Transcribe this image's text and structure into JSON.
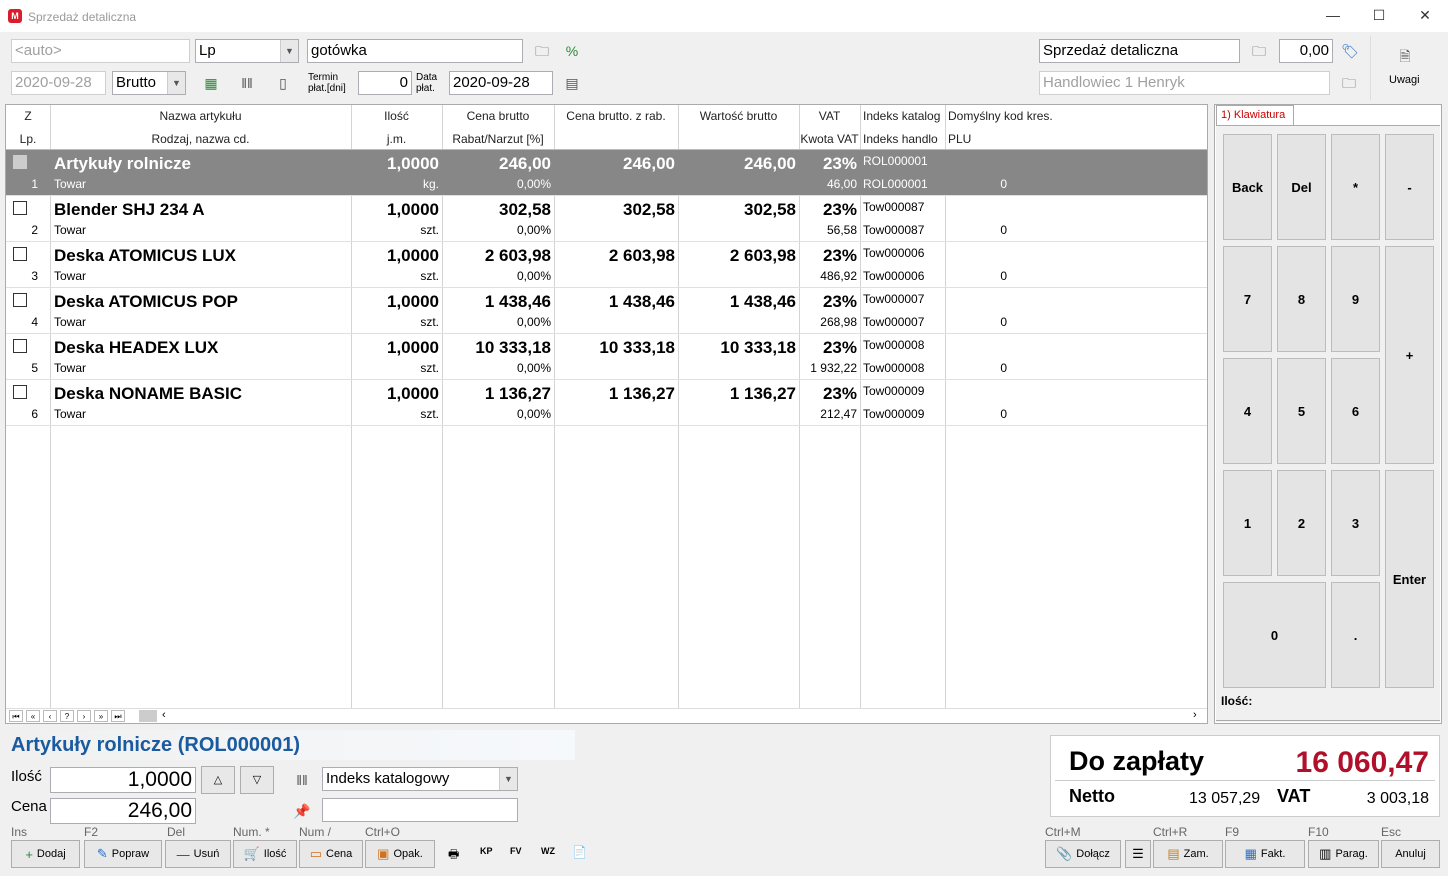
{
  "window": {
    "title": "Sprzedaż detaliczna",
    "app_icon": "M",
    "minimize": "—",
    "maximize": "☐",
    "close": "✕"
  },
  "header": {
    "doc_number_placeholder": "<auto>",
    "numbering": "Lp",
    "date": "2020-09-28",
    "price_type": "Brutto",
    "payment": "gotówka",
    "term_label": "Termin płat.[dni]",
    "term_value": "0",
    "due_label": "Data płat.",
    "due_date": "2020-09-28",
    "register": "Sprzedaż detaliczna",
    "amount": "0,00",
    "salesperson": "Handlowiec 1 Henryk",
    "notes_label": "Uwagi"
  },
  "grid": {
    "headers_top": [
      "Z",
      "Nazwa artykułu",
      "Ilość",
      "Cena brutto",
      "Cena brutto. z rab.",
      "Wartość brutto",
      "VAT",
      "Indeks katalog",
      "Domyślny kod kres."
    ],
    "headers_bottom": [
      "Lp.",
      "Rodzaj, nazwa cd.",
      "j.m.",
      "Rabat/Narzut [%]",
      "",
      "",
      "Kwota VAT",
      "Indeks handlo",
      "PLU"
    ],
    "rows": [
      {
        "lp": "1",
        "name": "Artykuły rolnicze",
        "type": "Towar",
        "qty": "1,0000",
        "unit": "kg.",
        "price": "246,00",
        "discount": "0,00%",
        "price_disc": "246,00",
        "value": "246,00",
        "vat": "23%",
        "vat_amount": "46,00",
        "cat_index": "ROL000001",
        "trade_index": "ROL000001",
        "plu": "0"
      },
      {
        "lp": "2",
        "name": "Blender SHJ 234 A",
        "type": "Towar",
        "qty": "1,0000",
        "unit": "szt.",
        "price": "302,58",
        "discount": "0,00%",
        "price_disc": "302,58",
        "value": "302,58",
        "vat": "23%",
        "vat_amount": "56,58",
        "cat_index": "Tow000087",
        "trade_index": "Tow000087",
        "plu": "0"
      },
      {
        "lp": "3",
        "name": "Deska ATOMICUS LUX",
        "type": "Towar",
        "qty": "1,0000",
        "unit": "szt.",
        "price": "2 603,98",
        "discount": "0,00%",
        "price_disc": "2 603,98",
        "value": "2 603,98",
        "vat": "23%",
        "vat_amount": "486,92",
        "cat_index": "Tow000006",
        "trade_index": "Tow000006",
        "plu": "0"
      },
      {
        "lp": "4",
        "name": "Deska ATOMICUS POP",
        "type": "Towar",
        "qty": "1,0000",
        "unit": "szt.",
        "price": "1 438,46",
        "discount": "0,00%",
        "price_disc": "1 438,46",
        "value": "1 438,46",
        "vat": "23%",
        "vat_amount": "268,98",
        "cat_index": "Tow000007",
        "trade_index": "Tow000007",
        "plu": "0"
      },
      {
        "lp": "5",
        "name": "Deska HEADEX LUX",
        "type": "Towar",
        "qty": "1,0000",
        "unit": "szt.",
        "price": "10 333,18",
        "discount": "0,00%",
        "price_disc": "10 333,18",
        "value": "10 333,18",
        "vat": "23%",
        "vat_amount": "1 932,22",
        "cat_index": "Tow000008",
        "trade_index": "Tow000008",
        "plu": "0"
      },
      {
        "lp": "6",
        "name": "Deska NONAME BASIC",
        "type": "Towar",
        "qty": "1,0000",
        "unit": "szt.",
        "price": "1 136,27",
        "discount": "0,00%",
        "price_disc": "1 136,27",
        "value": "1 136,27",
        "vat": "23%",
        "vat_amount": "212,47",
        "cat_index": "Tow000009",
        "trade_index": "Tow000009",
        "plu": "0"
      }
    ],
    "nav": [
      "⏮",
      "«",
      "‹",
      "?",
      "›",
      "»",
      "⏭"
    ]
  },
  "keypad": {
    "tab": "1) Klawiatura",
    "keys": [
      "Back",
      "Del",
      "*",
      "-",
      "7",
      "8",
      "9",
      "+",
      "4",
      "5",
      "6",
      "1",
      "2",
      "3",
      "Enter",
      "0",
      "."
    ],
    "qty_label": "Ilość:"
  },
  "bottom": {
    "selected_title": "Artykuły rolnicze (ROL000001)",
    "qty_label": "Ilość",
    "qty_value": "1,0000",
    "price_label": "Cena",
    "price_value": "246,00",
    "search_mode": "Indeks katalogowy",
    "buttons": [
      {
        "hint": "Ins",
        "label": "Dodaj",
        "icon": "+"
      },
      {
        "hint": "F2",
        "label": "Popraw",
        "icon": "✎"
      },
      {
        "hint": "Del",
        "label": "Usuń",
        "icon": "—"
      },
      {
        "hint": "Num. *",
        "label": "Ilość",
        "icon": "🛒"
      },
      {
        "hint": "Num /",
        "label": "Cena",
        "icon": "▭"
      },
      {
        "hint": "Ctrl+O",
        "label": "Opak.",
        "icon": "▣"
      }
    ],
    "doc_icons": [
      "🖶",
      "KP",
      "FV",
      "WZ",
      "📄"
    ],
    "right_buttons": [
      {
        "hint": "Ctrl+M",
        "label": "Dołącz",
        "icon": "📎"
      },
      {
        "hint": "",
        "label": "",
        "icon": "☰"
      },
      {
        "hint": "Ctrl+R",
        "label": "Zam.",
        "icon": "▤"
      },
      {
        "hint": "F9",
        "label": "Fakt.",
        "icon": "▦"
      },
      {
        "hint": "F10",
        "label": "Parag.",
        "icon": "▥"
      },
      {
        "hint": "Esc",
        "label": "Anuluj",
        "icon": ""
      }
    ]
  },
  "summary": {
    "to_pay_label": "Do zapłaty",
    "to_pay_value": "16 060,47",
    "net_label": "Netto",
    "net_value": "13 057,29",
    "vat_label": "VAT",
    "vat_value": "3 003,18"
  },
  "colors": {
    "accent_red": "#b0102a",
    "title_blue": "#1a5a9e",
    "selected_row": "#878787"
  }
}
